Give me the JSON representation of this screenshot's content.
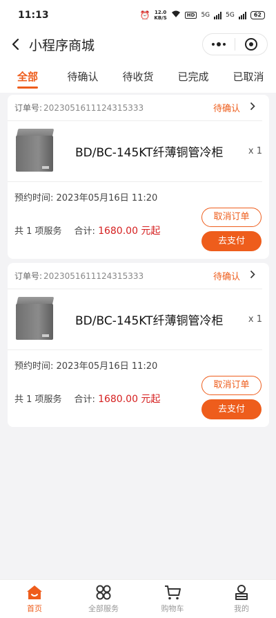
{
  "status_bar": {
    "time": "11:13",
    "speed": "12.0",
    "speed_unit": "KB/S",
    "network1": "5G",
    "network2": "5G",
    "hd": "HD",
    "battery": "62"
  },
  "nav": {
    "title": "小程序商城"
  },
  "tabs": [
    {
      "label": "全部",
      "active": true
    },
    {
      "label": "待确认",
      "active": false
    },
    {
      "label": "待收货",
      "active": false
    },
    {
      "label": "已完成",
      "active": false
    },
    {
      "label": "已取消",
      "active": false
    }
  ],
  "orders": [
    {
      "order_no_label": "订单号:",
      "order_no": "2023051611124315333",
      "status": "待确认",
      "product_name": "BD/BC-145KT纤薄铜管冷柜",
      "quantity": "x 1",
      "time_label": "预约时间:",
      "time": "2023年05月16日 11:20",
      "service_count": "共 1 项服务",
      "total_label": "合计:",
      "total": "1680.00 元起",
      "cancel_label": "取消订单",
      "pay_label": "去支付"
    },
    {
      "order_no_label": "订单号:",
      "order_no": "2023051611124315333",
      "status": "待确认",
      "product_name": "BD/BC-145KT纤薄铜管冷柜",
      "quantity": "x 1",
      "time_label": "预约时间:",
      "time": "2023年05月16日 11:20",
      "service_count": "共 1 项服务",
      "total_label": "合计:",
      "total": "1680.00 元起",
      "cancel_label": "取消订单",
      "pay_label": "去支付"
    }
  ],
  "tabbar": [
    {
      "label": "首页",
      "icon": "home-icon",
      "active": true
    },
    {
      "label": "全部服务",
      "icon": "grid-icon",
      "active": false
    },
    {
      "label": "购物车",
      "icon": "cart-icon",
      "active": false
    },
    {
      "label": "我的",
      "icon": "user-icon",
      "active": false
    }
  ],
  "colors": {
    "accent": "#ee5d1c",
    "price": "#d51f1f"
  }
}
